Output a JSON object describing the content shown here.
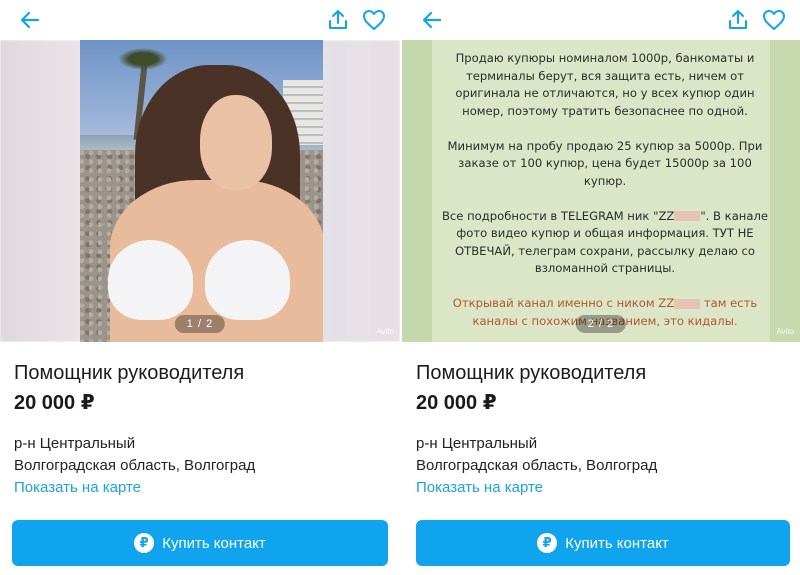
{
  "colors": {
    "accent": "#10a3ee",
    "link": "#1ba3e3",
    "warning_text": "#b4572a"
  },
  "icons": {
    "back": "arrow-left-icon",
    "share": "share-icon",
    "favorite": "heart-icon",
    "currency": "ruble-icon"
  },
  "listings": [
    {
      "gallery_counter": "1 / 2",
      "watermark": "Avito",
      "title": "Помощник руководителя",
      "price": "20 000 ₽",
      "district": "р-н Центральный",
      "region": "Волгоградская область, Волгоград",
      "map_link": "Показать на карте",
      "buy_label": "Купить контакт",
      "currency_symbol": "₽"
    },
    {
      "gallery_counter": "2 / 2",
      "watermark": "Avito",
      "title": "Помощник руководителя",
      "price": "20 000 ₽",
      "district": "р-н Центральный",
      "region": "Волгоградская область, Волгоград",
      "map_link": "Показать на карте",
      "buy_label": "Купить контакт",
      "currency_symbol": "₽",
      "image_text": {
        "p1": "Продаю купюры номиналом 1000р, банкоматы и терминалы берут, вся защита есть, ничем от оригинала не отличаются, но у всех купюр один номер, поэтому тратить безопаснее по одной.",
        "p2": "Минимум на пробу продаю 25 купюр за 5000р. При заказе от 100 купюр, цена будет 15000р за 100 купюр.",
        "p3a": "Все подробности в TELEGRAM ник \"ZZ",
        "p3b": "\". В канале фото видео купюр и общая информация. ТУТ НЕ ОТВЕЧАЙ, телеграм сохрани, рассылку делаю со взломанной страницы.",
        "p4a": "Открывай канал именно с ником ZZ",
        "p4b": " там есть каналы с похожим названием, это кидалы."
      }
    }
  ]
}
